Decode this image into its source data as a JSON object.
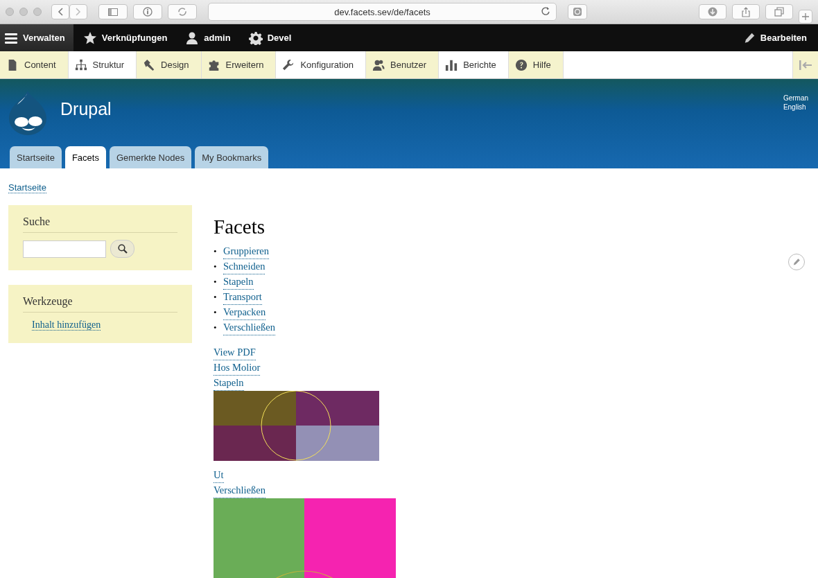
{
  "browser": {
    "url": "dev.facets.sev/de/facets"
  },
  "toolbar": {
    "items": [
      {
        "label": "Verwalten",
        "selected": true
      },
      {
        "label": "Verknüpfungen",
        "selected": false
      },
      {
        "label": "admin",
        "selected": false
      },
      {
        "label": "Devel",
        "selected": false
      }
    ],
    "edit": {
      "label": "Bearbeiten"
    }
  },
  "tray": {
    "items": [
      {
        "label": "Content"
      },
      {
        "label": "Struktur"
      },
      {
        "label": "Design"
      },
      {
        "label": "Erweitern"
      },
      {
        "label": "Konfiguration"
      },
      {
        "label": "Benutzer"
      },
      {
        "label": "Berichte"
      },
      {
        "label": "Hilfe"
      }
    ]
  },
  "site": {
    "name": "Drupal",
    "languages": [
      "German",
      "English"
    ]
  },
  "tabs": [
    {
      "label": "Startseite",
      "selected": false
    },
    {
      "label": "Facets",
      "selected": true
    },
    {
      "label": "Gemerkte Nodes",
      "selected": false
    },
    {
      "label": "My Bookmarks",
      "selected": false
    }
  ],
  "breadcrumb": [
    "Startseite"
  ],
  "sidebar": {
    "search": {
      "title": "Suche"
    },
    "tools": {
      "title": "Werkzeuge",
      "links": [
        "Inhalt hinzufügen"
      ]
    }
  },
  "content": {
    "title": "Facets",
    "facets": [
      {
        "bullet": "•",
        "label": "Gruppieren"
      },
      {
        "bullet": "•",
        "label": "Schneiden"
      },
      {
        "bullet": "•",
        "label": "Stapeln"
      },
      {
        "bullet": "•",
        "label": "Transport"
      },
      {
        "bullet": "•",
        "label": "Verpacken"
      },
      {
        "bullet": "•",
        "label": "Verschließen"
      }
    ],
    "items": [
      {
        "kind": "link",
        "text": "View PDF"
      },
      {
        "kind": "link",
        "text": "Hos Molior"
      },
      {
        "kind": "link",
        "text": "Stapeln"
      },
      {
        "kind": "picture"
      },
      {
        "kind": "link",
        "text": "Ut"
      },
      {
        "kind": "link",
        "text": "Verschließen"
      },
      {
        "kind": "picture"
      }
    ]
  }
}
